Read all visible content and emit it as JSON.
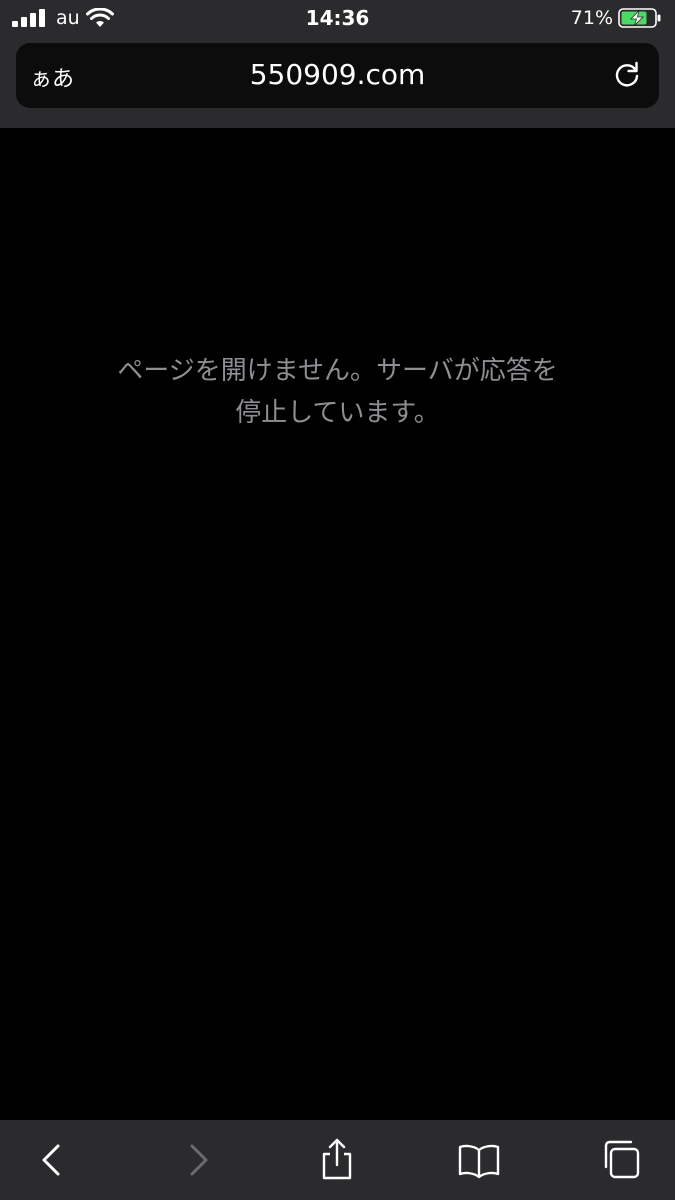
{
  "status_bar": {
    "carrier": "au",
    "time": "14:36",
    "battery_percent": "71%"
  },
  "url_bar": {
    "reader_label": "ぁあ",
    "url": "550909.com"
  },
  "content": {
    "error_line1": "ページを開けません。サーバが応答を",
    "error_line2": "停止しています。"
  },
  "toolbar": {
    "buttons": [
      "back",
      "forward",
      "share",
      "bookmarks",
      "tabs"
    ],
    "forward_enabled": false
  },
  "colors": {
    "chrome_bg": "#2b2b2d",
    "urlfield_bg": "#0c0c0d",
    "error_text": "#8e8e93",
    "battery_charging": "#4cd964"
  }
}
